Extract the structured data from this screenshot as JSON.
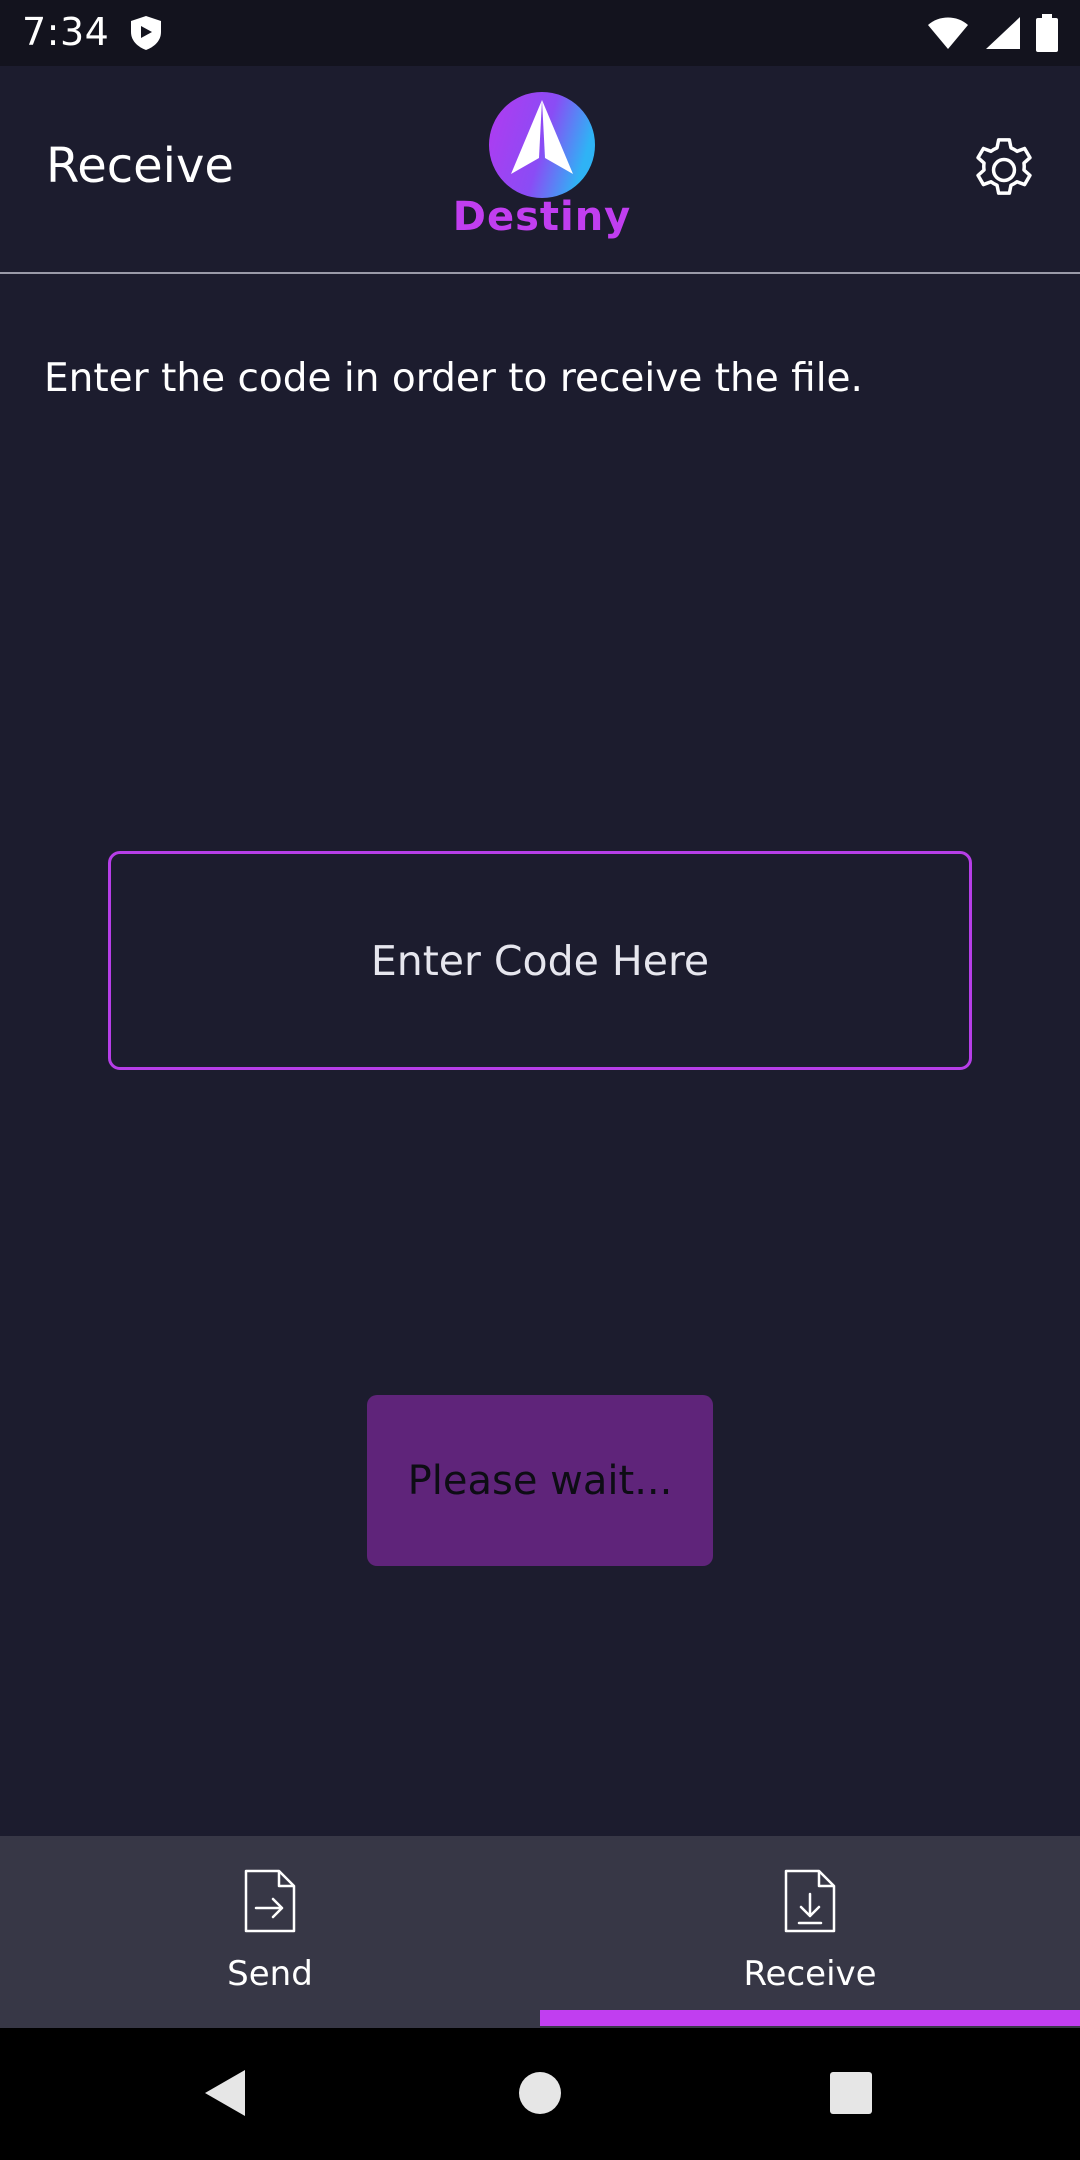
{
  "status_bar": {
    "time": "7:34",
    "icons": [
      "shield-icon",
      "wifi-icon",
      "signal-icon",
      "battery-icon"
    ]
  },
  "app_bar": {
    "title": "Receive",
    "logo_text": "Destiny",
    "settings_icon": "gear-icon"
  },
  "main": {
    "instruction": "Enter the code in order to receive the file.",
    "code_input": {
      "placeholder": "Enter Code Here",
      "value": ""
    },
    "wait_button_label": "Please wait..."
  },
  "bottom_nav": {
    "tabs": [
      {
        "label": "Send",
        "icon": "file-send-icon",
        "selected": false
      },
      {
        "label": "Receive",
        "icon": "file-receive-icon",
        "selected": true
      }
    ]
  },
  "system_nav": {
    "buttons": [
      "back-icon",
      "home-icon",
      "recents-icon"
    ]
  },
  "colors": {
    "background": "#1c1c2e",
    "accent": "#c13ef0",
    "button": "#5f247a",
    "nav_background": "#373746"
  }
}
